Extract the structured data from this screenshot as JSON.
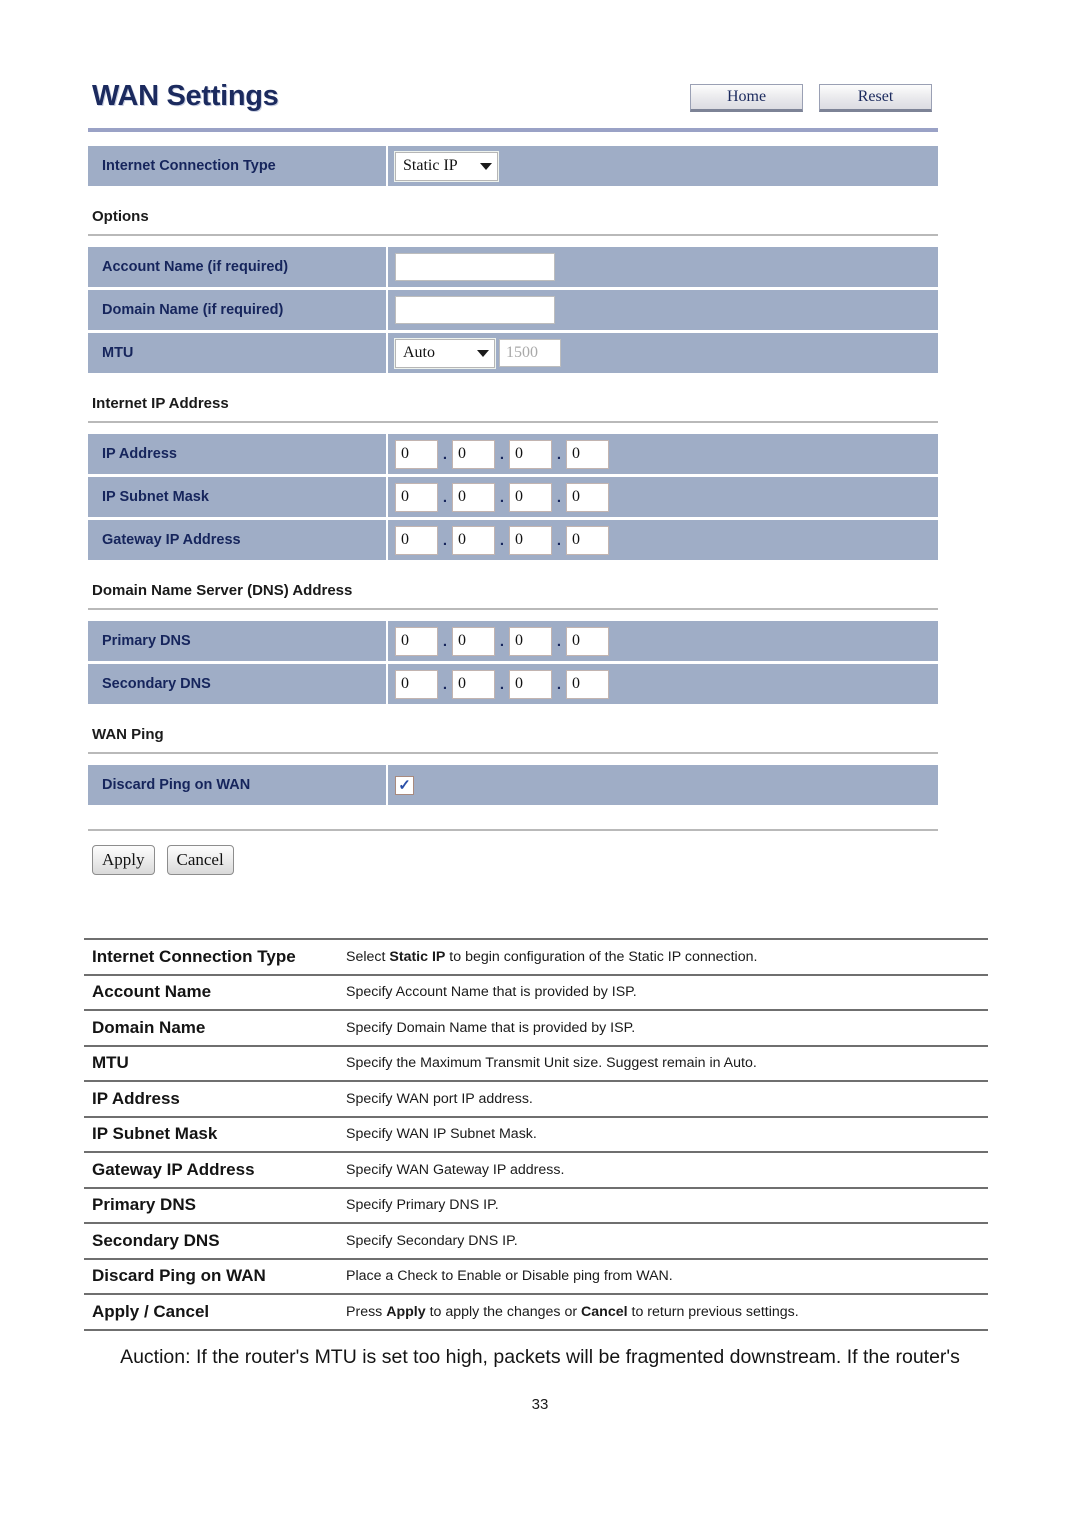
{
  "panel": {
    "title": "WAN Settings",
    "buttons": [
      {
        "label": "Home",
        "name": "home-button"
      },
      {
        "label": "Reset",
        "name": "reset-button"
      }
    ],
    "connection_row": {
      "label": "Internet Connection Type",
      "selected": "Static IP"
    },
    "sections": [
      {
        "heading": "Options",
        "rows": [
          {
            "label": "Account Name (if required)",
            "type": "text",
            "value": ""
          },
          {
            "label": "Domain Name (if required)",
            "type": "text",
            "value": ""
          },
          {
            "label": "MTU",
            "type": "mtu",
            "selected": "Auto",
            "value": "1500"
          }
        ]
      },
      {
        "heading": "Internet IP Address",
        "rows": [
          {
            "label": "IP Address",
            "type": "octets",
            "octets": [
              "0",
              "0",
              "0",
              "0"
            ]
          },
          {
            "label": "IP Subnet Mask",
            "type": "octets",
            "octets": [
              "0",
              "0",
              "0",
              "0"
            ]
          },
          {
            "label": "Gateway IP Address",
            "type": "octets",
            "octets": [
              "0",
              "0",
              "0",
              "0"
            ]
          }
        ]
      },
      {
        "heading": "Domain Name Server (DNS) Address",
        "rows": [
          {
            "label": "Primary DNS",
            "type": "octets",
            "octets": [
              "0",
              "0",
              "0",
              "0"
            ]
          },
          {
            "label": "Secondary DNS",
            "type": "octets",
            "octets": [
              "0",
              "0",
              "0",
              "0"
            ]
          }
        ]
      },
      {
        "heading": "WAN Ping",
        "rows": [
          {
            "label": "Discard Ping on WAN",
            "type": "checkbox",
            "checked": true,
            "mark": "✓"
          }
        ]
      }
    ],
    "actions": [
      {
        "label": "Apply",
        "name": "apply-button"
      },
      {
        "label": "Cancel",
        "name": "cancel-button"
      }
    ]
  },
  "descriptions": [
    {
      "term": "Internet Connection Type",
      "pre": "Select ",
      "strong": "Static IP",
      "post": " to begin configuration of the Static IP connection."
    },
    {
      "term": "Account Name",
      "pre": "Specify Account Name that is provided by ISP.",
      "strong": "",
      "post": ""
    },
    {
      "term": "Domain Name",
      "pre": "Specify Domain Name that is provided by ISP.",
      "strong": "",
      "post": ""
    },
    {
      "term": "MTU",
      "pre": "Specify the Maximum Transmit Unit size. Suggest remain in Auto.",
      "strong": "",
      "post": ""
    },
    {
      "term": "IP Address",
      "pre": "Specify WAN port IP address.",
      "strong": "",
      "post": ""
    },
    {
      "term": "IP Subnet Mask",
      "pre": "Specify WAN IP Subnet Mask.",
      "strong": "",
      "post": ""
    },
    {
      "term": "Gateway IP Address",
      "pre": "Specify WAN Gateway IP address.",
      "strong": "",
      "post": ""
    },
    {
      "term": "Primary DNS",
      "pre": "Specify Primary DNS IP.",
      "strong": "",
      "post": ""
    },
    {
      "term": "Secondary DNS",
      "pre": "Specify Secondary DNS IP.",
      "strong": "",
      "post": ""
    },
    {
      "term": "Discard Ping on WAN",
      "pre": "Place a Check to Enable or Disable ping from WAN.",
      "strong": "",
      "post": ""
    },
    {
      "term": "Apply / Cancel",
      "pre": "Press ",
      "strong": "Apply",
      "post": " to apply the changes or ",
      "strong2": "Cancel",
      "post2": " to return previous settings."
    }
  ],
  "footer": {
    "note": "Auction: If the router's MTU is set too high, packets will be fragmented downstream. If the router's",
    "page_number": "33"
  },
  "colors": {
    "row_bg": "#9fadc6",
    "label_text": "#16255c",
    "title_text": "#1b2a5e",
    "divider": "#9aa2c6"
  }
}
